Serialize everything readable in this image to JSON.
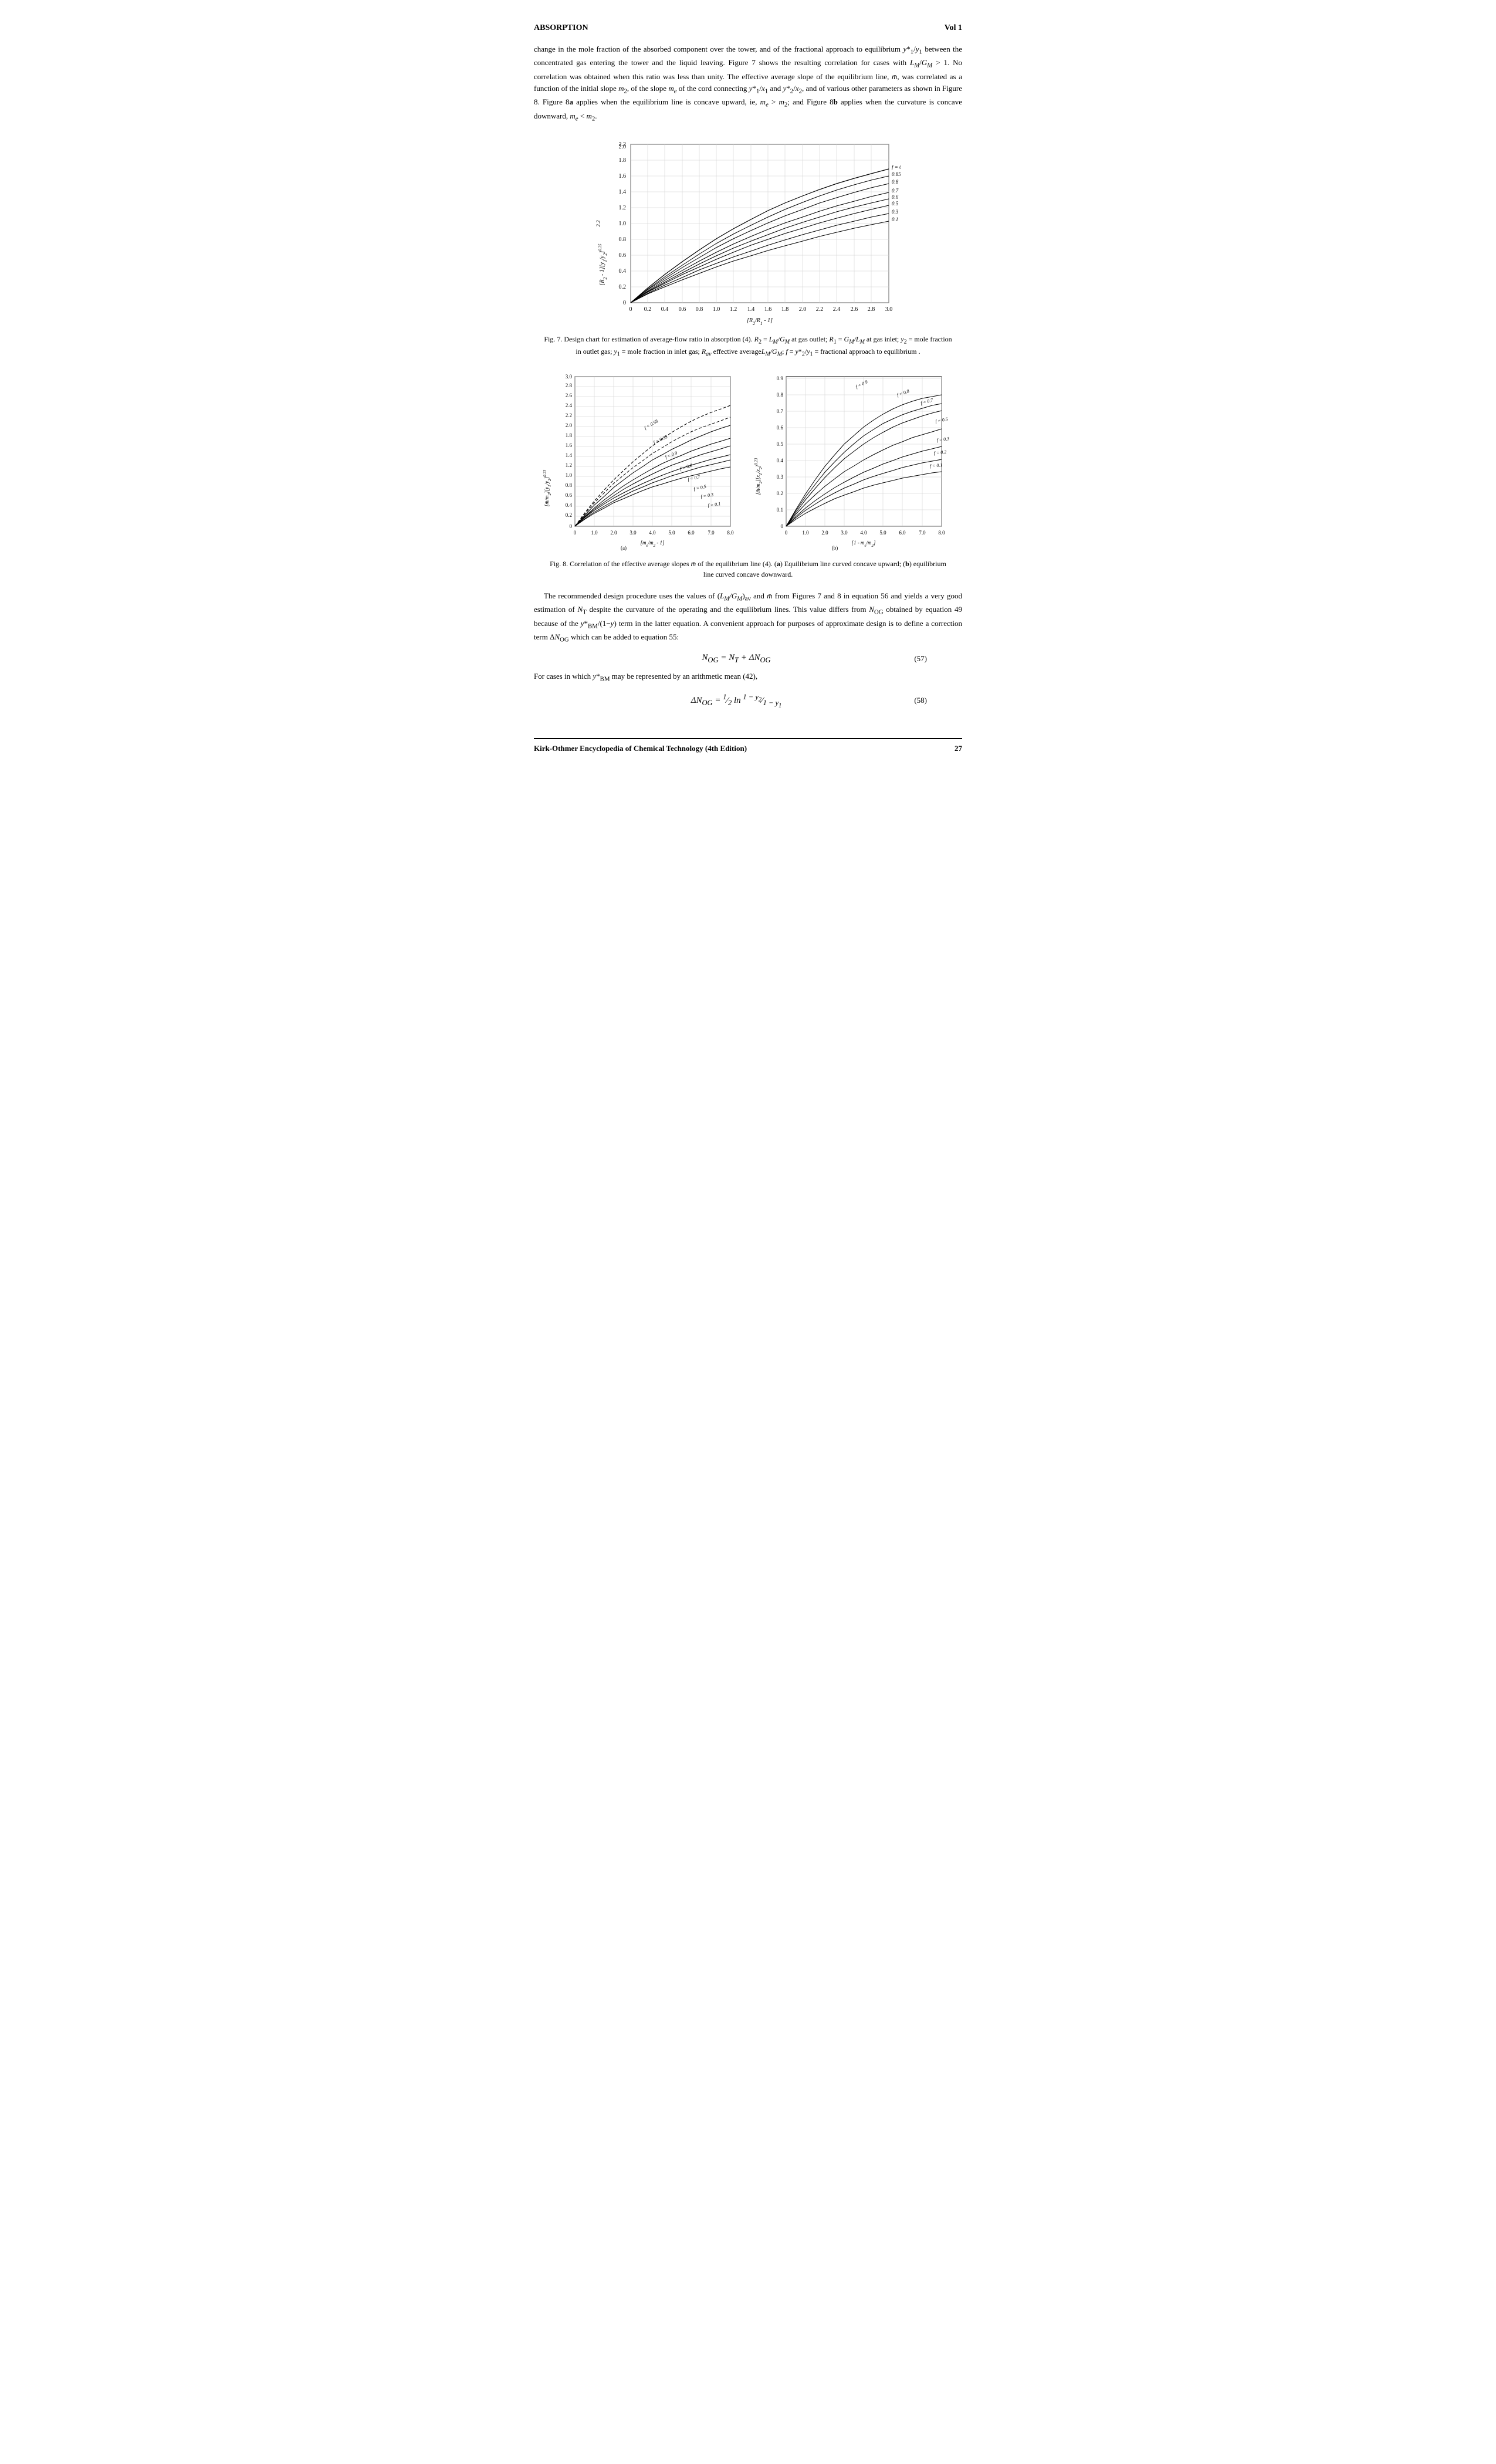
{
  "header": {
    "left": "ABSORPTION",
    "right": "Vol 1"
  },
  "paragraphs": [
    "change in the mole fraction of the absorbed component over the tower, and of the fractional approach to equilibrium y*₁/y₁ between the concentrated gas entering the tower and the liquid leaving. Figure 7 shows the resulting correlation for cases with L_M/G_M > 1. No correlation was obtained when this ratio was less than unity. The effective average slope of the equilibrium line, m̄, was correlated as a function of the initial slope m₂, of the slope m_e of the cord connecting y*₁/x₁ and y*₂/x₂, and of various other parameters as shown in Figure 8. Figure 8a applies when the equilibrium line is concave upward, ie, m_e > m₂; and Figure 8b applies when the curvature is concave downward, m_e < m₂.",
    "The recommended design procedure uses the values of (L_M/G_M)_av and m̄ from Figures 7 and 8 in equation 56 and yields a very good estimation of N_T despite the curvature of the operating and the equilibrium lines. This value differs from N_OG obtained by equation 49 because of the y*BM/(1−y) term in the latter equation. A convenient approach for purposes of approximate design is to define a correction term ΔN_OG which can be added to equation 55:",
    "For cases in which y*BM may be represented by an arithmetic mean (42),"
  ],
  "fig7_caption": "Fig. 7. Design chart for estimation of average-flow ratio in absorption (4). R₂ = L_M/G_M at gas outlet; R₁ = G_M/L_M at gas inlet; y₂ = mole fraction in outlet gas; y₁ = mole fraction in inlet gas; R_av effective average L_M/G_M; f = y*₂/y₁ = fractional approach to equilibrium.",
  "fig8_caption": "Fig. 8. Correlation of the effective average slopes m̄ of the equilibrium line (4). (a) Equilibrium line curved concave upward; (b) equilibrium line curved concave downward.",
  "equation57_lhs": "N_OG = N_T + ΔN_OG",
  "equation57_num": "(57)",
  "equation58_lhs": "ΔN_OG = ½ ln(1−y₂)/(1−y₁)",
  "equation58_num": "(58)",
  "footer_left": "Kirk-Othmer Encyclopedia of Chemical Technology (4th Edition)",
  "footer_right": "27"
}
